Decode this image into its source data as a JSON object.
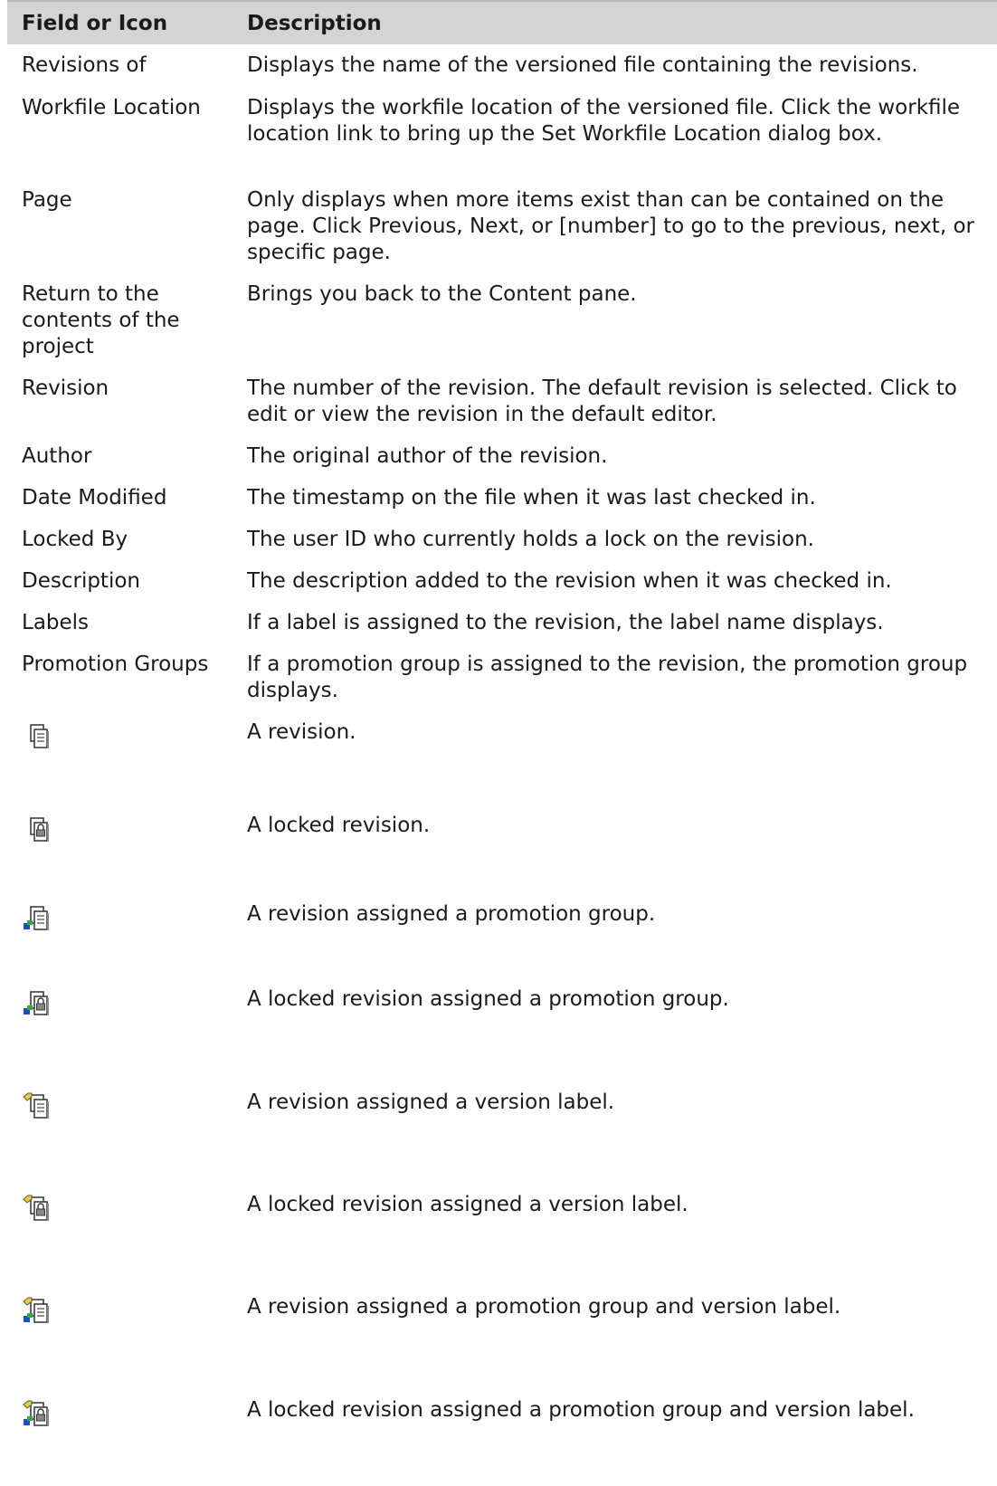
{
  "header": {
    "col1": "Field or Icon",
    "col2": "Description"
  },
  "rows": [
    {
      "field": "Revisions of",
      "desc": "Displays the name of the versioned file containing the revisions."
    },
    {
      "field": "Workfile Location",
      "desc": "Displays the workfile location of the versioned file. Click the workfile location link to bring up the Set Workfile Location dialog box."
    },
    {
      "field": "Page",
      "desc": "Only displays when more items exist than can be contained on the page. Click Previous, Next, or [number] to go to the previous, next, or specific page."
    },
    {
      "field": "Return to the contents of the project",
      "desc": "Brings you back to the Content pane."
    },
    {
      "field": "Revision",
      "desc": "The number of the revision. The default revision is selected. Click to edit or view the revision in the default editor."
    },
    {
      "field": "Author",
      "desc": "The original author of the revision."
    },
    {
      "field": "Date Modified",
      "desc": "The timestamp on the file when it was last checked in."
    },
    {
      "field": "Locked By",
      "desc": "The user ID who currently holds a lock on the revision."
    },
    {
      "field": "Description",
      "desc": "The description added to the revision when it was checked in."
    },
    {
      "field": "Labels",
      "desc": "If a label is assigned to the revision, the label name displays."
    },
    {
      "field": "Promotion Groups",
      "desc": "If a promotion group is assigned to the revision, the promotion group displays."
    }
  ],
  "icon_rows": [
    {
      "icon": "revision-icon",
      "desc": "A revision."
    },
    {
      "icon": "locked-revision-icon",
      "desc": "A locked revision."
    },
    {
      "icon": "revision-promotion-group-icon",
      "desc": "A revision assigned a promotion group."
    },
    {
      "icon": "locked-revision-promotion-group-icon",
      "desc": "A locked revision assigned a promotion group."
    },
    {
      "icon": "revision-version-label-icon",
      "desc": "A revision assigned a version label."
    },
    {
      "icon": "locked-revision-version-label-icon",
      "desc": "A locked revision assigned a version label."
    },
    {
      "icon": "revision-promotion-group-version-label-icon",
      "desc": "A revision assigned a promotion group and version label."
    },
    {
      "icon": "locked-revision-promotion-group-version-label-icon",
      "desc": "A locked revision assigned a promotion group and version label."
    }
  ],
  "colors": {
    "header_bg": "#d4d4d4",
    "promotion_blue": "#1f4fb8",
    "promotion_green": "#3aa63a",
    "label_yellow": "#e8d22a"
  }
}
